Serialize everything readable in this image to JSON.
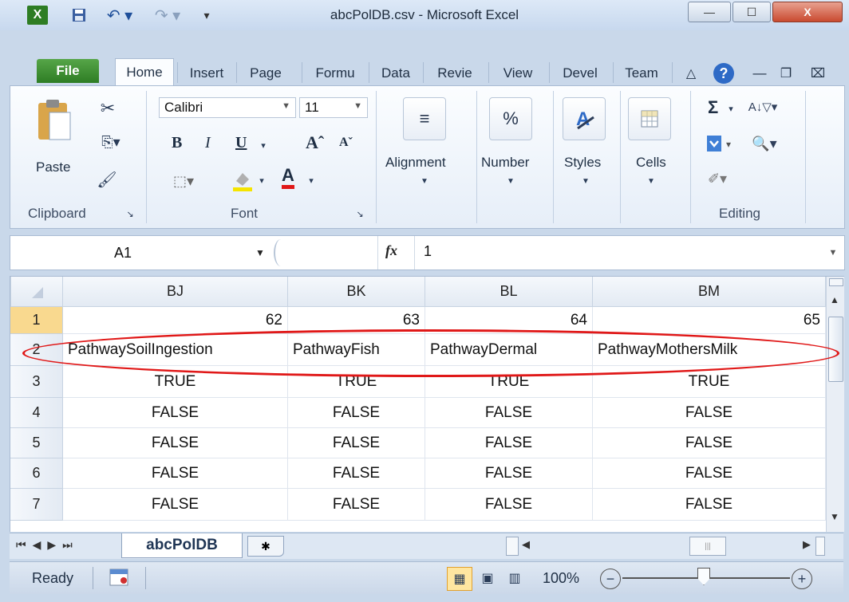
{
  "window": {
    "title": "abcPolDB.csv  -  Microsoft Excel",
    "controls": {
      "minimize": "—",
      "maximize": "☐",
      "close": "X"
    }
  },
  "quick_access": {
    "app_icon": "X",
    "save_icon": "save-icon",
    "undo_icon": "undo-icon",
    "redo_icon": "redo-icon"
  },
  "tabs": [
    {
      "label": "File"
    },
    {
      "label": "Home"
    },
    {
      "label": "Insert"
    },
    {
      "label": "Page"
    },
    {
      "label": "Formu"
    },
    {
      "label": "Data"
    },
    {
      "label": "Revie"
    },
    {
      "label": "View"
    },
    {
      "label": "Devel"
    },
    {
      "label": "Team"
    }
  ],
  "ribbon": {
    "clipboard": {
      "label": "Clipboard",
      "paste": "Paste"
    },
    "font": {
      "label": "Font",
      "family": "Calibri",
      "size": "11",
      "bold": "B",
      "italic": "I",
      "underline": "U",
      "grow": "Aˆ",
      "shrink": "Aˇ",
      "font_color_glyph": "A"
    },
    "alignment": {
      "label": "Alignment"
    },
    "number": {
      "label": "Number",
      "glyph": "%"
    },
    "styles": {
      "label": "Styles"
    },
    "cells": {
      "label": "Cells"
    },
    "editing": {
      "label": "Editing",
      "sum_glyph": "Σ"
    }
  },
  "formula_bar": {
    "name_box": "A1",
    "fx": "fx",
    "value": "1"
  },
  "grid": {
    "columns": [
      "BJ",
      "BK",
      "BL",
      "BM"
    ],
    "rows": [
      {
        "num": "1",
        "cells": [
          "62",
          "63",
          "64",
          "65"
        ]
      },
      {
        "num": "2",
        "cells": [
          "PathwaySoilIngestion",
          "PathwayFish",
          "PathwayDermal",
          "PathwayMothersMilk"
        ]
      },
      {
        "num": "3",
        "cells": [
          "TRUE",
          "TRUE",
          "TRUE",
          "TRUE"
        ]
      },
      {
        "num": "4",
        "cells": [
          "FALSE",
          "FALSE",
          "FALSE",
          "FALSE"
        ]
      },
      {
        "num": "5",
        "cells": [
          "FALSE",
          "FALSE",
          "FALSE",
          "FALSE"
        ]
      },
      {
        "num": "6",
        "cells": [
          "FALSE",
          "FALSE",
          "FALSE",
          "FALSE"
        ]
      },
      {
        "num": "7",
        "cells": [
          "FALSE",
          "FALSE",
          "FALSE",
          "FALSE"
        ]
      }
    ]
  },
  "sheets": {
    "active": "abcPolDB"
  },
  "status": {
    "mode": "Ready",
    "zoom": "100%"
  },
  "colors": {
    "annotation": "#e01818",
    "file_tab": "#2e7d24",
    "selected_row_header": "#f9d98f"
  }
}
